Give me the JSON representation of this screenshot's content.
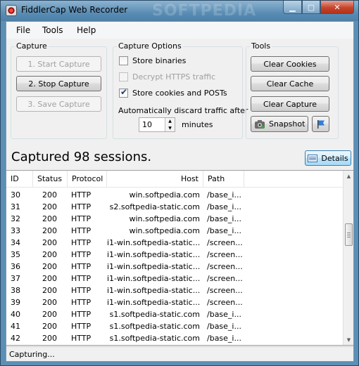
{
  "window": {
    "title": "FiddlerCap Web Recorder",
    "watermark": "SOFTPEDIA"
  },
  "menu": {
    "file": "File",
    "tools": "Tools",
    "help": "Help"
  },
  "capture": {
    "title": "Capture",
    "start": "1. Start Capture",
    "stop": "2. Stop Capture",
    "save": "3. Save Capture"
  },
  "options": {
    "title": "Capture Options",
    "store_binaries": "Store binaries",
    "decrypt_https": "Decrypt HTTPS traffic",
    "store_cookies": "Store cookies and POSTs",
    "discard_label": "Automatically discard traffic after",
    "discard_value": "10",
    "minutes": "minutes"
  },
  "tools": {
    "title": "Tools",
    "clear_cookies": "Clear Cookies",
    "clear_cache": "Clear Cache",
    "clear_capture": "Clear Capture",
    "snapshot": "Snapshot"
  },
  "summary": {
    "captured": "Captured 98 sessions.",
    "details": "Details"
  },
  "grid": {
    "headers": {
      "id": "ID",
      "status": "Status",
      "protocol": "Protocol",
      "host": "Host",
      "path": "Path"
    },
    "rows": [
      {
        "id": "30",
        "status": "200",
        "protocol": "HTTP",
        "host": "win.softpedia.com",
        "path": "/base_i..."
      },
      {
        "id": "31",
        "status": "200",
        "protocol": "HTTP",
        "host": "s2.softpedia-static.com",
        "path": "/base_i..."
      },
      {
        "id": "32",
        "status": "200",
        "protocol": "HTTP",
        "host": "win.softpedia.com",
        "path": "/base_i..."
      },
      {
        "id": "33",
        "status": "200",
        "protocol": "HTTP",
        "host": "win.softpedia.com",
        "path": "/base_i..."
      },
      {
        "id": "34",
        "status": "200",
        "protocol": "HTTP",
        "host": "i1-win.softpedia-static...",
        "path": "/screen..."
      },
      {
        "id": "35",
        "status": "200",
        "protocol": "HTTP",
        "host": "i1-win.softpedia-static...",
        "path": "/screen..."
      },
      {
        "id": "36",
        "status": "200",
        "protocol": "HTTP",
        "host": "i1-win.softpedia-static...",
        "path": "/screen..."
      },
      {
        "id": "37",
        "status": "200",
        "protocol": "HTTP",
        "host": "i1-win.softpedia-static...",
        "path": "/screen..."
      },
      {
        "id": "38",
        "status": "200",
        "protocol": "HTTP",
        "host": "i1-win.softpedia-static...",
        "path": "/screen..."
      },
      {
        "id": "39",
        "status": "200",
        "protocol": "HTTP",
        "host": "i1-win.softpedia-static...",
        "path": "/screen..."
      },
      {
        "id": "40",
        "status": "200",
        "protocol": "HTTP",
        "host": "s1.softpedia-static.com",
        "path": "/base_i..."
      },
      {
        "id": "41",
        "status": "200",
        "protocol": "HTTP",
        "host": "s1.softpedia-static.com",
        "path": "/base_i..."
      },
      {
        "id": "42",
        "status": "200",
        "protocol": "HTTP",
        "host": "s1.softpedia-static.com",
        "path": "/base_i..."
      }
    ]
  },
  "status": {
    "text": "Capturing..."
  }
}
